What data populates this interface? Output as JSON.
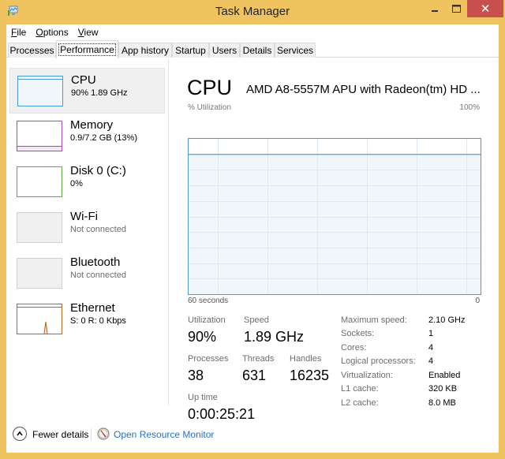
{
  "window": {
    "title": "Task Manager",
    "icons": {
      "app": "task-manager-icon",
      "minimize": "minimize-icon",
      "maximize": "maximize-icon",
      "close": "close-icon"
    },
    "close_glyph": "✕"
  },
  "menu": [
    {
      "label": "File",
      "accel": "F",
      "rest": "ile"
    },
    {
      "label": "Options",
      "accel": "O",
      "rest": "ptions"
    },
    {
      "label": "View",
      "accel": "V",
      "rest": "iew"
    }
  ],
  "tabs": [
    {
      "label": "Processes",
      "active": false
    },
    {
      "label": "Performance",
      "active": true
    },
    {
      "label": "App history",
      "active": false
    },
    {
      "label": "Startup",
      "active": false
    },
    {
      "label": "Users",
      "active": false
    },
    {
      "label": "Details",
      "active": false
    },
    {
      "label": "Services",
      "active": false
    }
  ],
  "sidebar": {
    "items": [
      {
        "name": "CPU",
        "sub": "90% 1.89 GHz",
        "color": "#4a9bd0",
        "selected": true
      },
      {
        "name": "Memory",
        "sub": "0.9/7.2 GB (13%)",
        "color": "#b042c8",
        "selected": false
      },
      {
        "name": "Disk 0 (C:)",
        "sub": "0%",
        "color": "#5bb33a",
        "selected": false
      },
      {
        "name": "Wi-Fi",
        "sub": "Not connected",
        "color": "#d0d0d0",
        "selected": false
      },
      {
        "name": "Bluetooth",
        "sub": "Not connected",
        "color": "#d0d0d0",
        "selected": false
      },
      {
        "name": "Ethernet",
        "sub": "S: 0 R: 0 Kbps",
        "color": "#b6651f",
        "selected": false
      }
    ]
  },
  "main": {
    "title": "CPU",
    "model": "AMD A8-5557M APU with Radeon(tm) HD ...",
    "graph": {
      "y_label": "% Utilization",
      "y_max_label": "100%",
      "x_left_label": "60 seconds",
      "x_right_label": "0",
      "current_utilization_percent": 90,
      "line_color": "#4a9bd0",
      "fill_color": "#f1f6fb",
      "grid_color": "#dce9f5"
    },
    "stats": {
      "utilization": {
        "label": "Utilization",
        "value": "90%"
      },
      "speed": {
        "label": "Speed",
        "value": "1.89 GHz"
      },
      "processes": {
        "label": "Processes",
        "value": "38"
      },
      "threads": {
        "label": "Threads",
        "value": "631"
      },
      "handles": {
        "label": "Handles",
        "value": "16235"
      },
      "uptime": {
        "label": "Up time",
        "value": "0:00:25:21"
      }
    },
    "details": [
      {
        "label": "Maximum speed:",
        "value": "2.10 GHz"
      },
      {
        "label": "Sockets:",
        "value": "1"
      },
      {
        "label": "Cores:",
        "value": "4"
      },
      {
        "label": "Logical processors:",
        "value": "4"
      },
      {
        "label": "Virtualization:",
        "value": "Enabled"
      },
      {
        "label": "L1 cache:",
        "value": "320 KB"
      },
      {
        "label": "L2 cache:",
        "value": "8.0 MB"
      }
    ]
  },
  "footer": {
    "fewer_details": {
      "label": "Fewer details",
      "icon": "chevron-up-circle-icon"
    },
    "resource_monitor": {
      "label": "Open Resource Monitor",
      "icon": "resource-monitor-icon"
    }
  }
}
